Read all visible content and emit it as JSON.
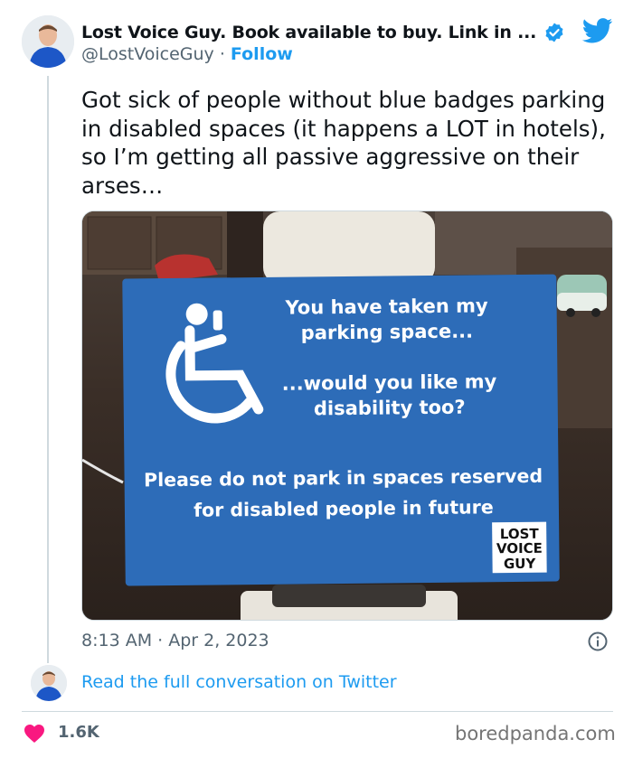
{
  "tweet": {
    "display_name": "Lost Voice Guy. Book available to buy. Link in ...",
    "handle": "@LostVoiceGuy",
    "separator": " · ",
    "follow_label": "Follow",
    "text": "Got sick of people without blue badges parking in disabled spaces (it happens a LOT in hotels), so I’m getting all passive aggressive on their arses…",
    "timestamp": "8:13 AM · Apr 2, 2023",
    "read_more": "Read the full conversation on Twitter",
    "likes": "1.6K"
  },
  "sign": {
    "line1": "You have taken my",
    "line2": "parking space...",
    "line3": "...would you like my",
    "line4": "disability too?",
    "line5": "Please do not park in spaces reserved",
    "line6": "for disabled people in future",
    "logo_line1": "LOST",
    "logo_line2": "VOICE",
    "logo_line3": "GUY"
  },
  "watermark": "boredpanda.com",
  "colors": {
    "accent": "#1d9bf0",
    "like": "#f91880",
    "sign_blue": "#2d6cb8"
  },
  "icons": [
    "verified-badge-icon",
    "twitter-bird-icon",
    "info-icon",
    "heart-icon"
  ]
}
